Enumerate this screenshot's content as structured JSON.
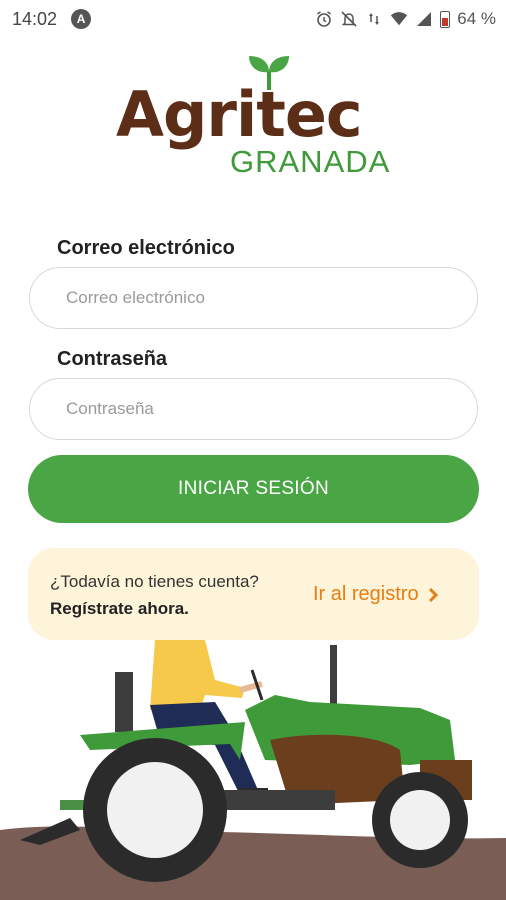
{
  "status_bar": {
    "time": "14:02",
    "app_icon": "A",
    "battery": "64 %"
  },
  "logo": {
    "word": "Agritec",
    "sub": "GRANADA"
  },
  "form": {
    "email_label": "Correo electrónico",
    "email_placeholder": "Correo electrónico",
    "password_label": "Contraseña",
    "password_placeholder": "Contraseña",
    "login_button": "INICIAR SESIÓN"
  },
  "register": {
    "question": "¿Todavía no tienes cuenta?",
    "cta": "Regístrate ahora.",
    "link": "Ir al registro",
    "link_icon": "chevron-right-icon"
  },
  "colors": {
    "brand_brown": "#5c2e17",
    "brand_green": "#4aa544",
    "register_bg": "#fdf4d9",
    "register_link": "#e67e13"
  }
}
